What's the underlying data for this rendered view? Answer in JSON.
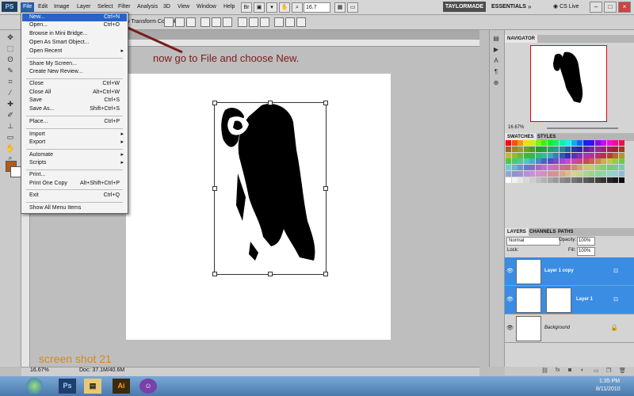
{
  "app": {
    "logo": "PS"
  },
  "menubar": {
    "items": [
      "File",
      "Edit",
      "Image",
      "Layer",
      "Select",
      "Filter",
      "Analysis",
      "3D",
      "View",
      "Window",
      "Help"
    ],
    "zoom": "16.7",
    "workspace_active": "TAYLORMADE",
    "workspace_other": "ESSENTIALS",
    "more": "»",
    "cs_live": "CS Live"
  },
  "options_bar": {
    "transform_controls": "Show Transform Controls"
  },
  "file_menu": {
    "items": [
      {
        "label": "New...",
        "shortcut": "Ctrl+N"
      },
      {
        "label": "Open...",
        "shortcut": "Ctrl+O"
      },
      {
        "label": "Browse in Mini Bridge...",
        "shortcut": ""
      },
      {
        "label": "Open As Smart Object...",
        "shortcut": ""
      },
      {
        "label": "Open Recent",
        "shortcut": "",
        "submenu": "▸"
      },
      {
        "label": "Share My Screen...",
        "shortcut": ""
      },
      {
        "label": "Create New Review...",
        "shortcut": ""
      },
      {
        "label": "Close",
        "shortcut": "Ctrl+W"
      },
      {
        "label": "Close All",
        "shortcut": "Alt+Ctrl+W"
      },
      {
        "label": "Save",
        "shortcut": "Ctrl+S"
      },
      {
        "label": "Save As...",
        "shortcut": "Shift+Ctrl+S"
      },
      {
        "label": "Place...",
        "shortcut": "Ctrl+P"
      },
      {
        "label": "Import",
        "shortcut": "",
        "submenu": "▸"
      },
      {
        "label": "Export",
        "shortcut": "",
        "submenu": "▸"
      },
      {
        "label": "Automate",
        "shortcut": "",
        "submenu": "▸"
      },
      {
        "label": "Scripts",
        "shortcut": "",
        "submenu": "▸"
      },
      {
        "label": "Print...",
        "shortcut": ""
      },
      {
        "label": "Print One Copy",
        "shortcut": "Alt+Shift+Ctrl+P"
      },
      {
        "label": "Exit",
        "shortcut": "Ctrl+Q"
      },
      {
        "label": "Show All Menu Items",
        "shortcut": ""
      }
    ]
  },
  "annotation": {
    "caption": "now go to File and choose New.",
    "label": "screen shot 21",
    "caption_color": "#7a1c1c",
    "label_color": "#d28a20"
  },
  "status": {
    "zoom": "16.67%",
    "doc": "Doc: 37.1M/40.6M"
  },
  "navigator": {
    "tab": "NAVIGATOR",
    "zoom": "16.67%"
  },
  "swatches": {
    "tabs": [
      "SWATCHES",
      "STYLES"
    ]
  },
  "layers": {
    "tabs": [
      "LAYERS",
      "CHANNELS",
      "PATHS"
    ],
    "blend_mode": "Normal",
    "opacity_label": "Opacity:",
    "opacity": "100%",
    "lock_label": "Lock:",
    "fill_label": "Fill:",
    "fill": "100%",
    "items": [
      {
        "name": "Layer 1 copy",
        "selected": true
      },
      {
        "name": "Layer 1",
        "selected": true
      },
      {
        "name": "Background",
        "selected": false
      }
    ]
  },
  "taskbar": {
    "time": "1:35 PM",
    "date": "8/11/2010",
    "apps": [
      "Ps",
      "Ai"
    ]
  },
  "colors": {
    "foreground": "#b3591b",
    "background": "#ffffff",
    "selection": "#3a8de3",
    "menu_highlight": "#2a62c7"
  }
}
